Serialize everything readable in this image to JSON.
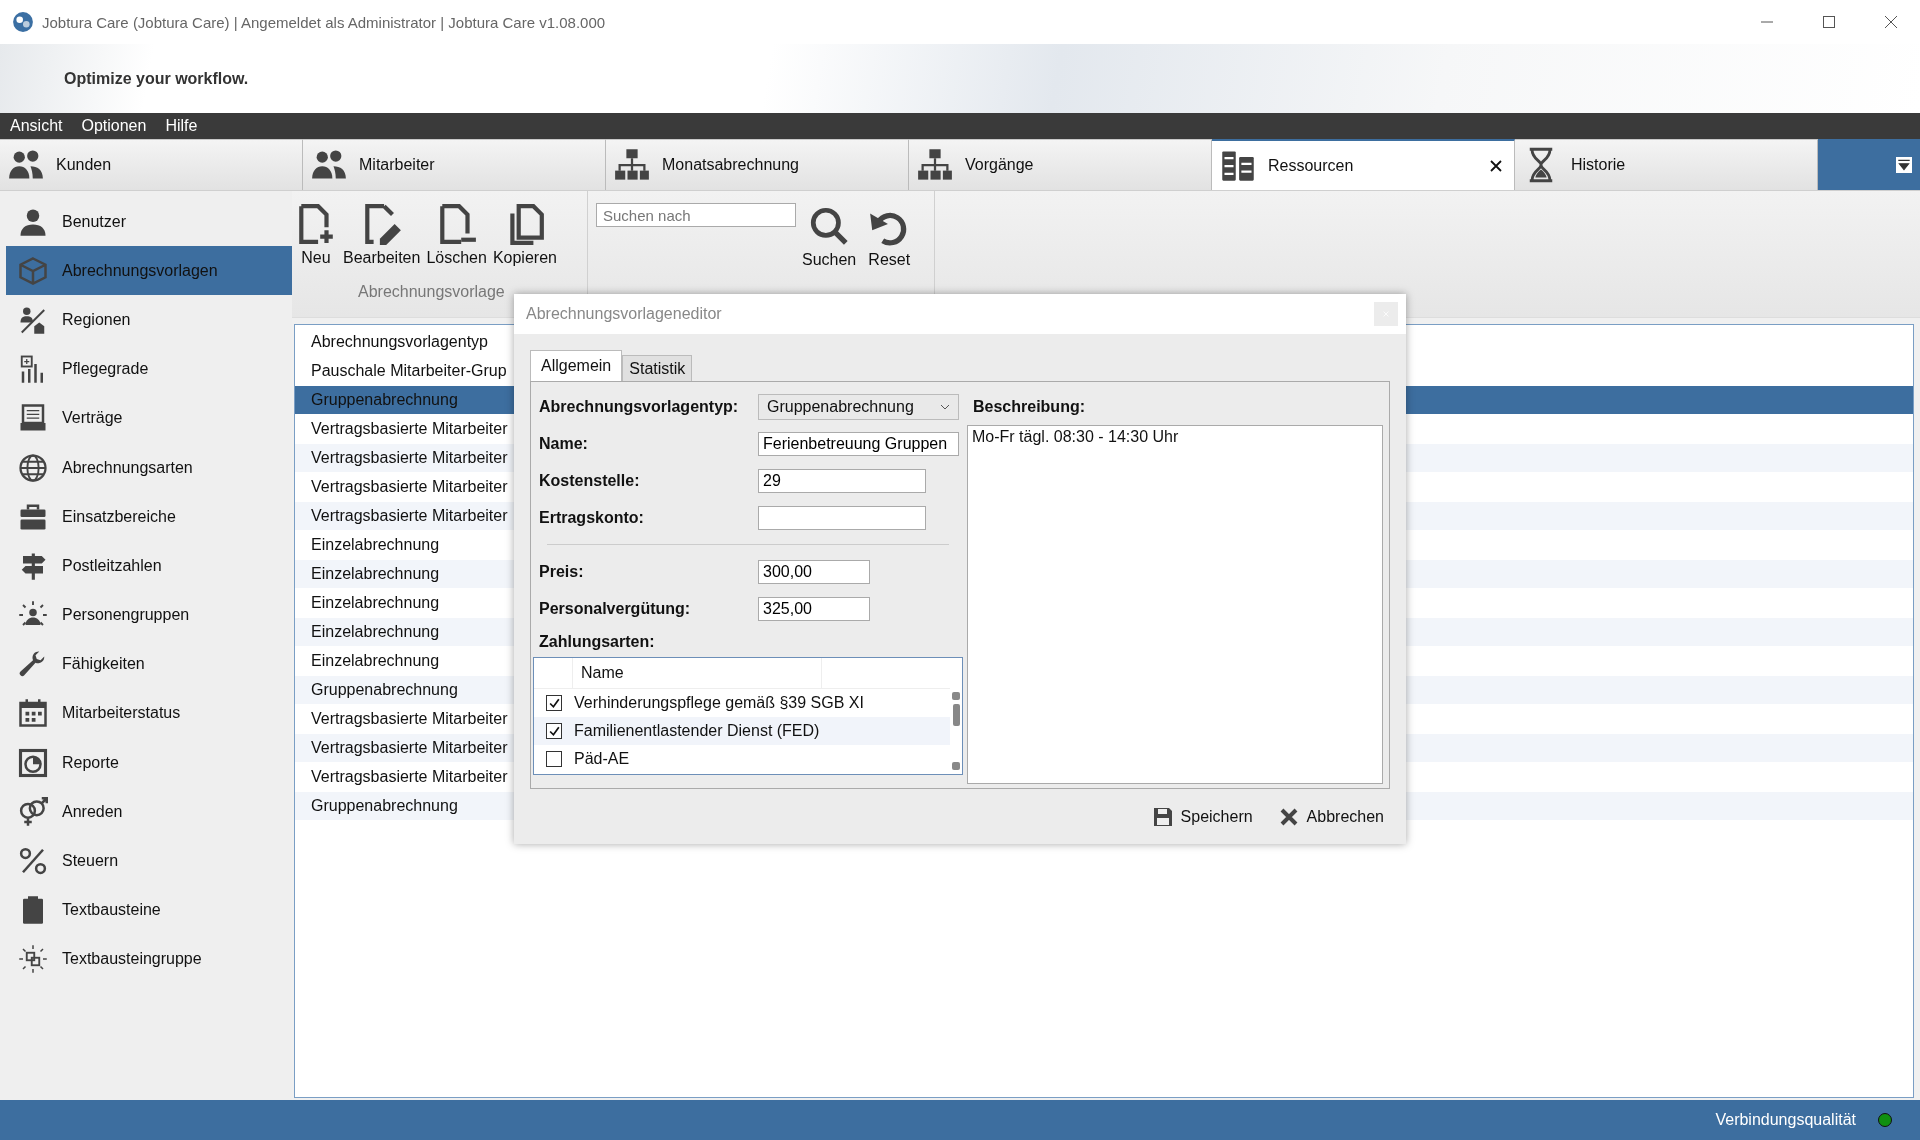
{
  "window": {
    "title": "Jobtura Care (Jobtura Care) | Angemeldet als Administrator | Jobtura Care v1.08.000"
  },
  "banner": {
    "slogan": "Optimize your workflow."
  },
  "menu": [
    "Ansicht",
    "Optionen",
    "Hilfe"
  ],
  "tabs": [
    {
      "label": "Kunden",
      "selected": false
    },
    {
      "label": "Mitarbeiter",
      "selected": false
    },
    {
      "label": "Monatsabrechnung",
      "selected": false
    },
    {
      "label": "Vorgänge",
      "selected": false
    },
    {
      "label": "Ressourcen",
      "selected": true
    },
    {
      "label": "Historie",
      "selected": false
    }
  ],
  "sidebar": {
    "items": [
      {
        "label": "Benutzer",
        "selected": false
      },
      {
        "label": "Abrechnungsvorlagen",
        "selected": true
      },
      {
        "label": "Regionen",
        "selected": false
      },
      {
        "label": "Pflegegrade",
        "selected": false
      },
      {
        "label": "Verträge",
        "selected": false
      },
      {
        "label": "Abrechnungsarten",
        "selected": false
      },
      {
        "label": "Einsatzbereiche",
        "selected": false
      },
      {
        "label": "Postleitzahlen",
        "selected": false
      },
      {
        "label": "Personengruppen",
        "selected": false
      },
      {
        "label": "Fähigkeiten",
        "selected": false
      },
      {
        "label": "Mitarbeiterstatus",
        "selected": false
      },
      {
        "label": "Reporte",
        "selected": false
      },
      {
        "label": "Anreden",
        "selected": false
      },
      {
        "label": "Steuern",
        "selected": false
      },
      {
        "label": "Textbausteine",
        "selected": false
      },
      {
        "label": "Textbausteingruppe",
        "selected": false
      }
    ]
  },
  "toolbar": {
    "group_label": "Abrechnungsvorlage",
    "buttons": [
      "Neu",
      "Bearbeiten",
      "Löschen",
      "Kopieren"
    ],
    "search": {
      "placeholder": "Suchen nach"
    },
    "search_buttons": [
      "Suchen",
      "Reset"
    ]
  },
  "list": {
    "columns": [
      "Abrechnungsvorlagentyp"
    ],
    "rows": [
      {
        "text": "Pauschale Mitarbeiter-Grup",
        "selected": false
      },
      {
        "text": "Gruppenabrechnung",
        "selected": true
      },
      {
        "text": "Vertragsbasierte Mitarbeiter",
        "selected": false
      },
      {
        "text": "Vertragsbasierte Mitarbeiter",
        "selected": false
      },
      {
        "text": "Vertragsbasierte Mitarbeiter",
        "selected": false
      },
      {
        "text": "Vertragsbasierte Mitarbeiter",
        "selected": false
      },
      {
        "text": "Einzelabrechnung",
        "selected": false
      },
      {
        "text": "Einzelabrechnung",
        "selected": false
      },
      {
        "text": "Einzelabrechnung",
        "selected": false
      },
      {
        "text": "Einzelabrechnung",
        "selected": false
      },
      {
        "text": "Einzelabrechnung",
        "selected": false
      },
      {
        "text": "Gruppenabrechnung",
        "selected": false
      },
      {
        "text": "Vertragsbasierte Mitarbeiter",
        "selected": false
      },
      {
        "text": "Vertragsbasierte Mitarbeiter",
        "selected": false
      },
      {
        "text": "Vertragsbasierte Mitarbeiter",
        "selected": false
      },
      {
        "text": "Gruppenabrechnung",
        "selected": false
      }
    ]
  },
  "dialog": {
    "title": "Abrechnungsvorlageneditor",
    "tabs": [
      {
        "label": "Allgemein",
        "selected": true
      },
      {
        "label": "Statistik",
        "selected": false
      }
    ],
    "fields": [
      {
        "label": "Abrechnungsvorlagentyp:",
        "kind": "select",
        "value": "Gruppenabrechnung"
      },
      {
        "label": "Name:",
        "kind": "text",
        "value": "Ferienbetreuung Gruppen"
      },
      {
        "label": "Kostenstelle:",
        "kind": "text",
        "value": "29"
      },
      {
        "label": "Ertragskonto:",
        "kind": "text"
      }
    ],
    "amounts": [
      {
        "label": "Preis:",
        "kind": "text",
        "value": "300,00"
      },
      {
        "label": "Personalvergütung:",
        "kind": "text",
        "value": "325,00"
      }
    ],
    "payment_types": {
      "label": "Zahlungsarten:",
      "columns": [
        "Name"
      ],
      "rows": [
        {
          "name": "Verhinderungspflege gemäß §39 SGB XI",
          "checked": true
        },
        {
          "name": "Familienentlastender Dienst (FED)",
          "checked": true
        },
        {
          "name": "Päd-AE",
          "checked": false
        }
      ]
    },
    "description": {
      "label": "Beschreibung:",
      "value": "Mo-Fr tägl. 08:30 - 14:30 Uhr"
    },
    "buttons": [
      "Speichern",
      "Abbrechen"
    ]
  },
  "status_bar": {
    "label": "Verbindungsqualität",
    "connected": true
  }
}
